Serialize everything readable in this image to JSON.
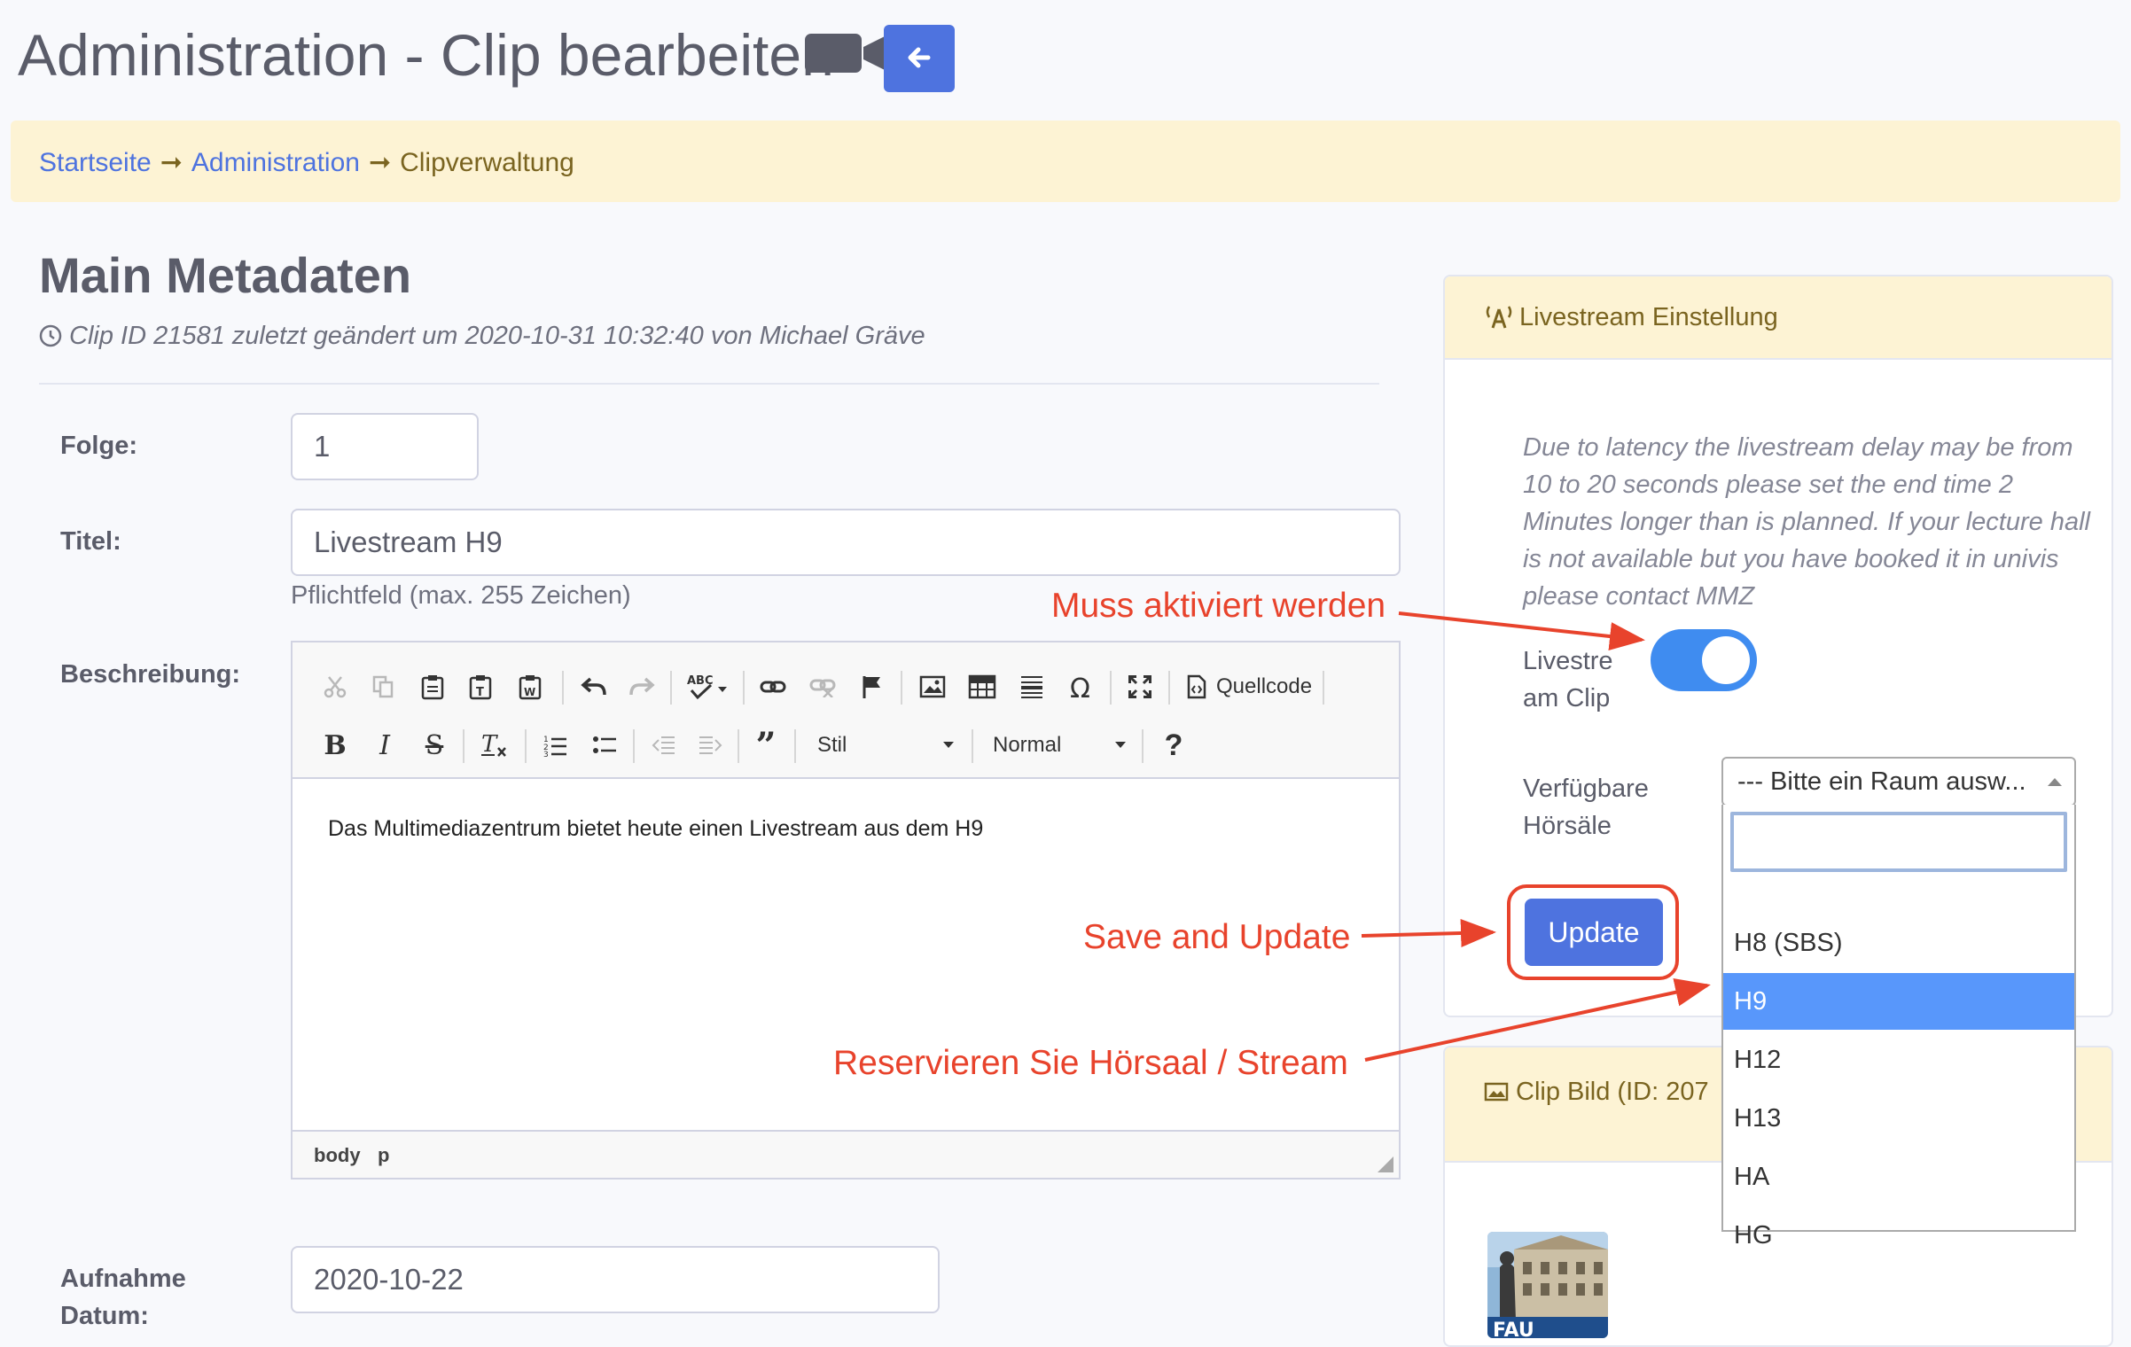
{
  "header": {
    "title": "Administration - Clip bearbeiten"
  },
  "breadcrumb": {
    "items": [
      "Startseite",
      "Administration",
      "Clipverwaltung"
    ],
    "separator": "➞"
  },
  "main": {
    "section_title": "Main Metadaten",
    "meta_line": "Clip ID 21581 zuletzt geändert um 2020-10-31 10:32:40 von Michael Gräve",
    "fields": {
      "folge_label": "Folge:",
      "folge_value": "1",
      "titel_label": "Titel:",
      "titel_value": "Livestream H9",
      "titel_hint": "Pflichtfeld (max. 255 Zeichen)",
      "beschreibung_label": "Beschreibung:",
      "datum_label": "Aufnahme Datum:",
      "datum_value": "2020-10-22"
    }
  },
  "editor": {
    "source_label": "Quellcode",
    "style_label": "Stil",
    "format_label": "Normal",
    "help_label": "?",
    "content": "Das Multimediazentrum bietet heute einen Livestream aus dem H9",
    "path": [
      "body",
      "p"
    ]
  },
  "livestream": {
    "title": "Livestream Einstellung",
    "note": "Due to latency the livestream delay may be from 10 to 20 seconds please set the end time 2 Minutes longer than is planned. If your lecture hall is not available but you have booked it in univis please contact MMZ",
    "toggle_label": "Livestre am Clip",
    "toggle_on": true,
    "rooms_label": "Verfügbare Hörsäle",
    "select_value": "--- Bitte ein Raum ausw...",
    "options": [
      "H8 (SBS)",
      "H9",
      "H12",
      "H13",
      "HA",
      "HG"
    ],
    "selected_option": "H9",
    "update_label": "Update"
  },
  "clip_bild": {
    "title": "Clip Bild (ID: 207",
    "thumb_text": "FAU"
  },
  "annotations": {
    "activate": "Muss aktiviert werden",
    "save": "Save and Update",
    "reserve": "Reservieren Sie Hörsaal / Stream"
  },
  "colors": {
    "primary": "#4e73df",
    "breadcrumb_bg": "#fdf3d4",
    "annotation": "#e8432c",
    "toggle": "#3f8cf0",
    "dropdown_highlight": "#5897fb"
  }
}
